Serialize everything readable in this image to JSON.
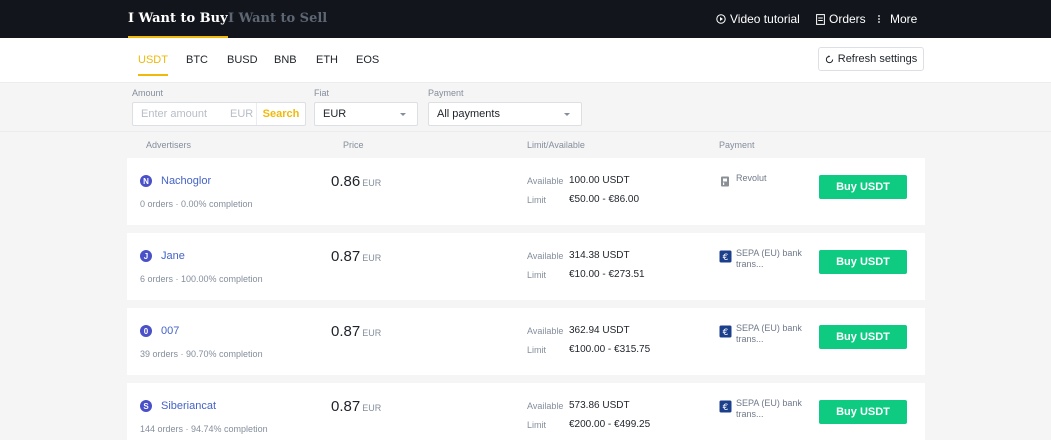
{
  "topbar": {
    "tabs": [
      {
        "label": "I Want to Buy",
        "active": true
      },
      {
        "label": "I Want to Sell",
        "active": false
      }
    ],
    "nav": {
      "video_tutorial": "Video tutorial",
      "orders": "Orders",
      "more": "More"
    }
  },
  "coins": [
    "USDT",
    "BTC",
    "BUSD",
    "BNB",
    "ETH",
    "EOS"
  ],
  "active_coin": "USDT",
  "refresh_label": "Refresh settings",
  "filters": {
    "amount": {
      "label": "Amount",
      "placeholder": "Enter amount",
      "unit": "EUR",
      "search_label": "Search"
    },
    "fiat": {
      "label": "Fiat",
      "value": "EUR"
    },
    "payment": {
      "label": "Payment",
      "value": "All payments"
    }
  },
  "columns": {
    "advertisers": "Advertisers",
    "price": "Price",
    "limit": "Limit/Available",
    "payment": "Payment"
  },
  "labels": {
    "available": "Available",
    "limit": "Limit",
    "buy": "Buy USDT"
  },
  "ads": [
    {
      "initial": "N",
      "name": "Nachoglor",
      "stats": "0 orders · 0.00% completion",
      "price": "0.86",
      "currency": "EUR",
      "available": "100.00 USDT",
      "limit": "€50.00 - €86.00",
      "payment": "Revolut",
      "payment_icon": "revolut-icon"
    },
    {
      "initial": "J",
      "name": "Jane",
      "stats": "6 orders · 100.00% completion",
      "price": "0.87",
      "currency": "EUR",
      "available": "314.38 USDT",
      "limit": "€10.00 - €273.51",
      "payment": "SEPA (EU) bank trans...",
      "payment_icon": "sepa-icon"
    },
    {
      "initial": "0",
      "name": "007",
      "stats": "39 orders · 90.70% completion",
      "price": "0.87",
      "currency": "EUR",
      "available": "362.94 USDT",
      "limit": "€100.00 - €315.75",
      "payment": "SEPA (EU) bank trans...",
      "payment_icon": "sepa-icon"
    },
    {
      "initial": "S",
      "name": "Siberiancat",
      "stats": "144 orders · 94.74% completion",
      "price": "0.87",
      "currency": "EUR",
      "available": "573.86 USDT",
      "limit": "€200.00 - €499.25",
      "payment": "SEPA (EU) bank trans...",
      "payment_icon": "sepa-icon"
    }
  ],
  "colors": {
    "accent": "#f0b90b",
    "buy": "#0ecb81",
    "topbar": "#12161c",
    "link": "#4463c8"
  }
}
